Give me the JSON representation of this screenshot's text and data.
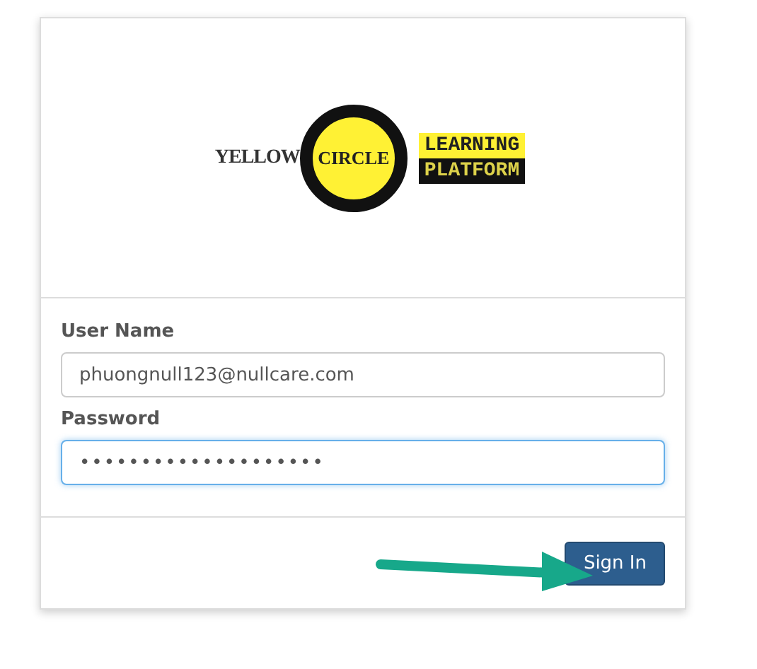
{
  "logo": {
    "left_word": "YELLOW",
    "circle_word": "CIRCLE",
    "banner_top": "LEARNING",
    "banner_bottom": "PLATFORM"
  },
  "fields": [
    {
      "label": "User Name",
      "value": "phuongnull123@nullcare.com",
      "focused": false
    },
    {
      "label": "Password",
      "value": "••••••••••••••••••••",
      "focused": true
    }
  ],
  "submit": {
    "label": "Sign In"
  }
}
